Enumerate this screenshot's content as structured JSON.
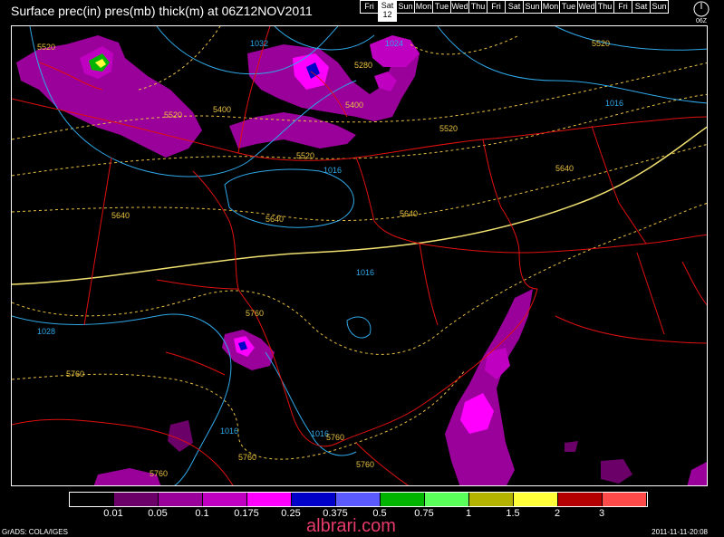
{
  "title": "Surface prec(in) pres(mb) thick(m) at 06Z12NOV2011",
  "days": [
    {
      "label": "Fri"
    },
    {
      "label": "Sat",
      "num": "12",
      "selected": true
    },
    {
      "label": "Sun"
    },
    {
      "label": "Mon"
    },
    {
      "label": "Tue"
    },
    {
      "label": "Wed"
    },
    {
      "label": "Thu"
    },
    {
      "label": "Fri"
    },
    {
      "label": "Sat"
    },
    {
      "label": "Sun"
    },
    {
      "label": "Mon"
    },
    {
      "label": "Tue"
    },
    {
      "label": "Wed"
    },
    {
      "label": "Thu"
    },
    {
      "label": "Fri"
    },
    {
      "label": "Sat"
    },
    {
      "label": "Sun"
    }
  ],
  "clock_label": "06Z",
  "legend": {
    "colors": [
      "#000000",
      "#6a0068",
      "#9a009a",
      "#c000c0",
      "#ff00ff",
      "#0000c8",
      "#5a5aff",
      "#00b400",
      "#5aff5a",
      "#b4b400",
      "#ffff3a",
      "#b40000",
      "#ff4a4a"
    ],
    "labels": [
      "0.01",
      "0.05",
      "0.1",
      "0.175",
      "0.25",
      "0.375",
      "0.5",
      "0.75",
      "1",
      "1.5",
      "2",
      "3"
    ]
  },
  "isobar_labels": [
    "1032",
    "1024",
    "1016",
    "1016",
    "1016",
    "1028",
    "1016",
    "1016"
  ],
  "thickness_labels": [
    "5520",
    "5520",
    "5400",
    "5280",
    "5400",
    "5520",
    "5520",
    "5520",
    "5640",
    "5640",
    "5640",
    "5640",
    "5760",
    "5760",
    "5760",
    "5760",
    "5760",
    "5760"
  ],
  "footer_left": "GrADS: COLA/IGES",
  "footer_right": "2011-11-11-20:08",
  "watermark": "albrari.com",
  "colors": {
    "isobar": "#2fa8e8",
    "thickness": "#e8c040",
    "borders": "#e01010"
  }
}
